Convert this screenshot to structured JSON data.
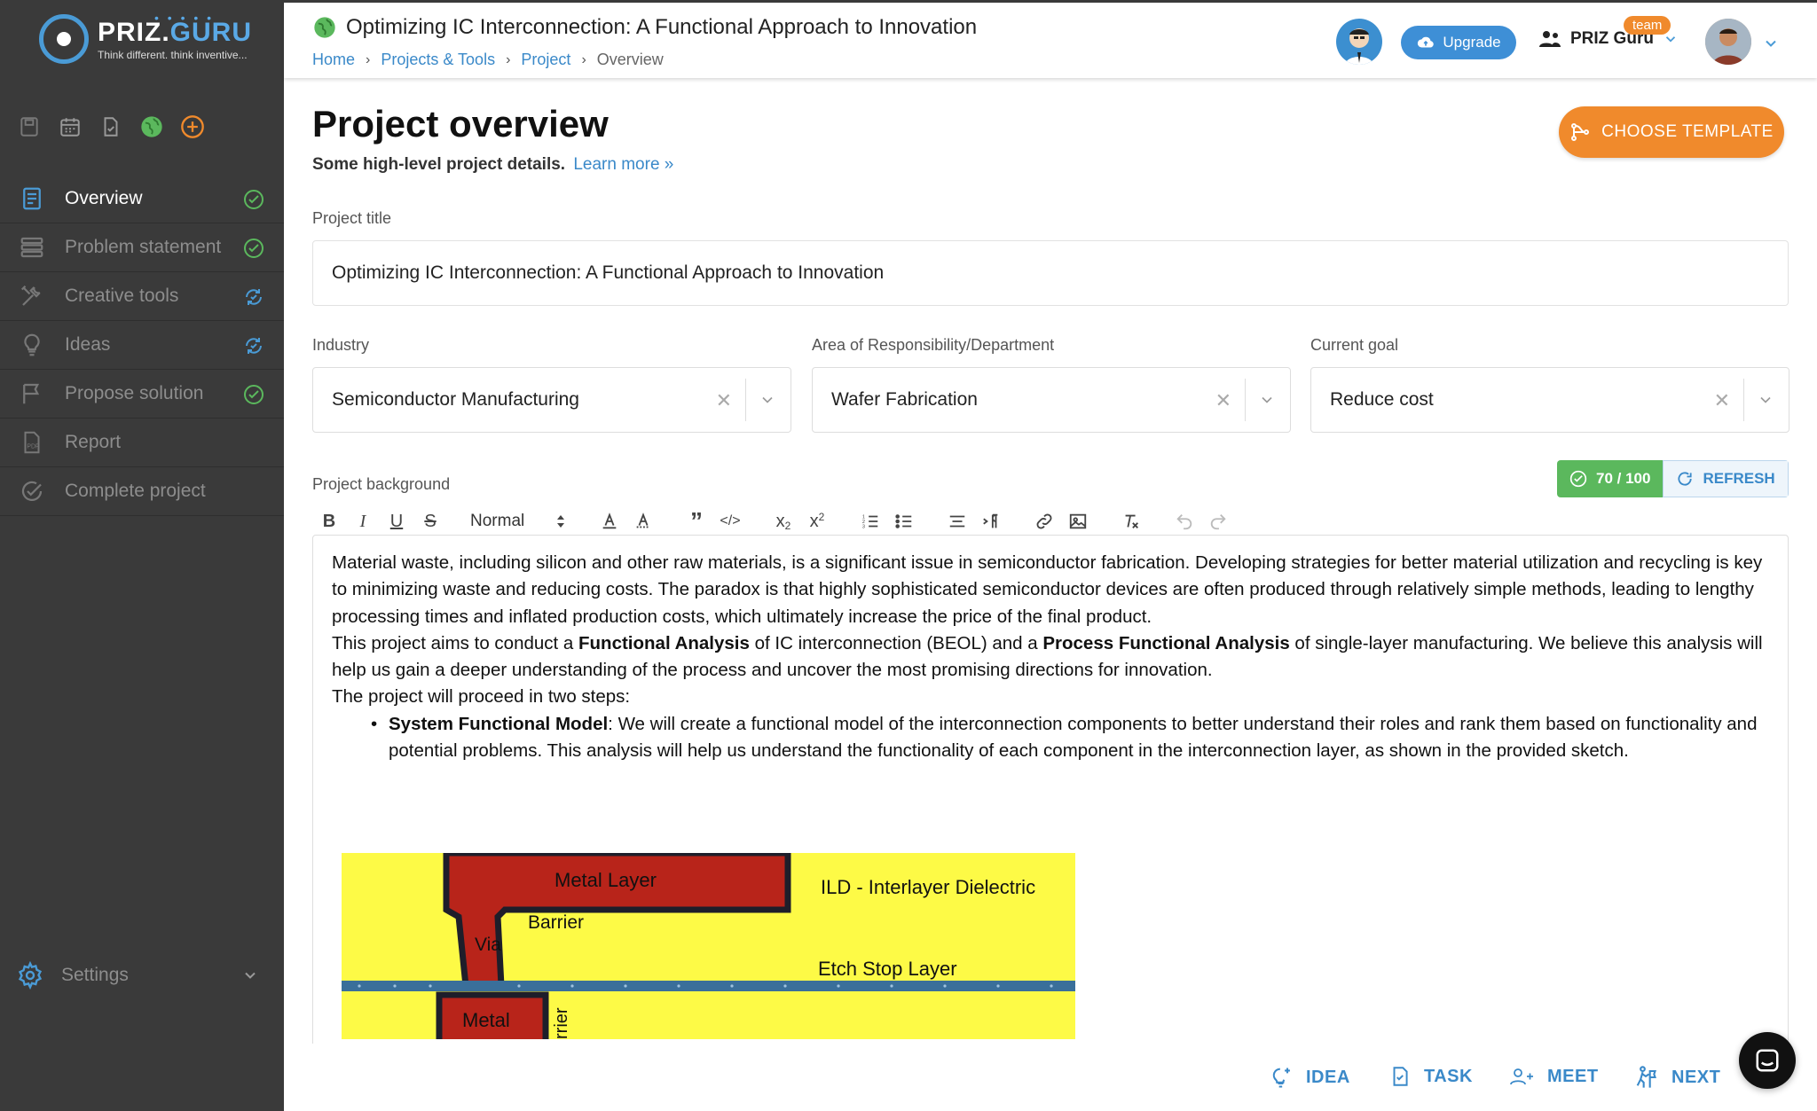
{
  "brand": {
    "name_a": "PRIZ.",
    "name_b": "GURU",
    "tagline": "Think different. think inventive..."
  },
  "sidebar": {
    "items": [
      {
        "label": "Overview",
        "icon": "clipboard-icon",
        "status": "done",
        "active": true
      },
      {
        "label": "Problem statement",
        "icon": "stack-icon",
        "status": "done"
      },
      {
        "label": "Creative tools",
        "icon": "tools-icon",
        "status": "progress"
      },
      {
        "label": "Ideas",
        "icon": "lightbulb-icon",
        "status": "progress"
      },
      {
        "label": "Propose solution",
        "icon": "flag-icon",
        "status": "done"
      },
      {
        "label": "Report",
        "icon": "pdf-icon",
        "status": "none"
      },
      {
        "label": "Complete project",
        "icon": "check-icon",
        "status": "none"
      }
    ],
    "settings_label": "Settings"
  },
  "header": {
    "title": "Optimizing IC Interconnection: A Functional Approach to Innovation",
    "breadcrumb": [
      "Home",
      "Projects & Tools",
      "Project",
      "Overview"
    ],
    "upgrade_label": "Upgrade",
    "team_name": "PRIZ Guru",
    "team_badge": "team"
  },
  "main": {
    "page_title": "Project overview",
    "page_subtitle": "Some high-level project details.",
    "learn_more": "Learn more »",
    "choose_template": "CHOOSE TEMPLATE",
    "project_title_label": "Project title",
    "project_title_value": "Optimizing IC Interconnection: A Functional Approach to Innovation",
    "industry_label": "Industry",
    "industry_value": "Semiconductor Manufacturing",
    "area_label": "Area of Responsibility/Department",
    "area_value": "Wafer Fabrication",
    "goal_label": "Current goal",
    "goal_value": "Reduce cost",
    "background_label": "Project background",
    "score": "70 / 100",
    "refresh_label": "REFRESH",
    "toolbar_format": "Normal",
    "background": {
      "p1": "Material waste, including silicon and other raw materials, is a significant issue in semiconductor fabrication. Developing strategies for better material utilization and recycling is key to minimizing waste and reducing costs. The paradox is that highly sophisticated semiconductor devices are often produced through relatively simple methods, leading to lengthy processing times and inflated production costs, which ultimately increase the price of the final product.",
      "p2_a": "This project aims to conduct a ",
      "p2_b": "Functional Analysis",
      "p2_c": " of IC interconnection (BEOL) and a ",
      "p2_d": "Process Functional Analysis",
      "p2_e": " of single-layer manufacturing. We believe this analysis will help us gain a deeper understanding of the process and uncover the most promising directions for innovation.",
      "p3": "The project will proceed in two steps:",
      "li1_a": "System Functional Model",
      "li1_b": ": We will create a functional model of the interconnection components to better understand their roles and rank them based on functionality and potential problems. This analysis will help us understand the functionality of each component in the interconnection layer, as shown in the provided sketch."
    },
    "sketch": {
      "metal_layer": "Metal Layer",
      "ild": "ILD - Interlayer Dielectric",
      "barrier": "Barrier",
      "via": "Via",
      "etch_stop": "Etch Stop Layer",
      "metal": "Metal",
      "barrier_vertical": "rrier"
    }
  },
  "footer": {
    "idea": "IDEA",
    "task": "TASK",
    "meet": "MEET",
    "next": "NEXT"
  },
  "colors": {
    "accent": "#3a89c9",
    "orange": "#f08a2c",
    "green": "#5bb85d",
    "sidebar": "#3a3a3a"
  }
}
